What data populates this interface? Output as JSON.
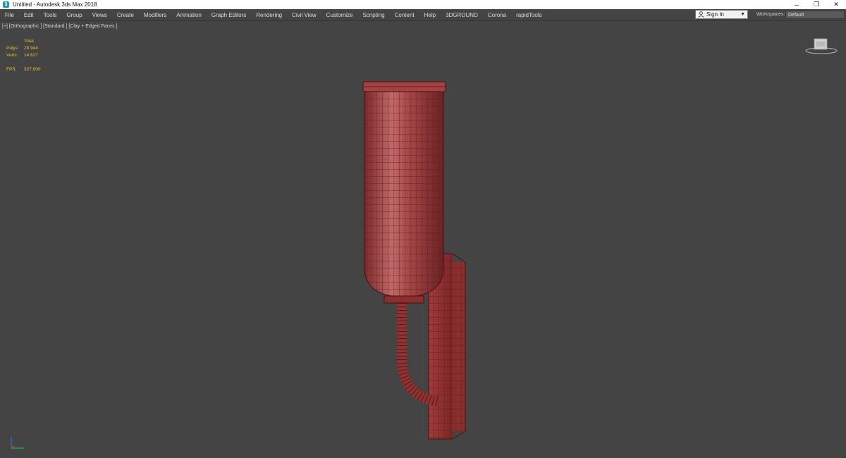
{
  "window": {
    "title": "Untitled - Autodesk 3ds Max 2018",
    "controls": {
      "minimize": "─",
      "restore": "❐",
      "close": "✕"
    }
  },
  "menu": [
    "File",
    "Edit",
    "Tools",
    "Group",
    "Views",
    "Create",
    "Modifiers",
    "Animation",
    "Graph Editors",
    "Rendering",
    "Civil View",
    "Customize",
    "Scripting",
    "Content",
    "Help",
    "3DGROUND",
    "Corona",
    "rapidTools"
  ],
  "account": {
    "signin_label": "Sign In",
    "caret": "▼"
  },
  "workspaces": {
    "label": "Workspaces:",
    "value": "Default"
  },
  "viewport": {
    "label": "[+] [Orthographic ] [Standard ] [Clay + Edged Faces ]",
    "stats": {
      "header": "Total",
      "polys_label": "Polys:",
      "polys_value": "28 944",
      "verts_label": "Verts:",
      "verts_value": "14 627",
      "fps_label": "FPS:",
      "fps_value": "327,000"
    }
  },
  "colors": {
    "accent_stats": "#e5c12a",
    "model_fill": "#9a3a3a",
    "model_wire": "#5c1616",
    "viewport_bg": "#444444"
  }
}
